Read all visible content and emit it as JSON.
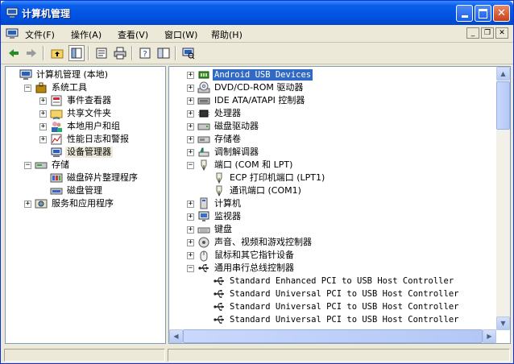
{
  "window": {
    "title": "计算机管理"
  },
  "menu": [
    {
      "label": "文件(F)"
    },
    {
      "label": "操作(A)"
    },
    {
      "label": "查看(V)"
    },
    {
      "label": "窗口(W)"
    },
    {
      "label": "帮助(H)"
    }
  ],
  "toolbar": {
    "icons": [
      "back-arrow-icon",
      "forward-arrow-icon",
      "up-folder-icon",
      "show-hide-tree-icon",
      "properties-icon",
      "print-icon",
      "help-icon",
      "export-list-icon",
      "scan-hardware-icon"
    ]
  },
  "left_tree": [
    {
      "label": "计算机管理 (本地)",
      "level": 0,
      "exp": "",
      "icon": "computer-management-icon"
    },
    {
      "label": "系统工具",
      "level": 1,
      "exp": "-",
      "icon": "system-tools-icon"
    },
    {
      "label": "事件查看器",
      "level": 2,
      "exp": "+",
      "icon": "event-viewer-icon"
    },
    {
      "label": "共享文件夹",
      "level": 2,
      "exp": "+",
      "icon": "shared-folder-icon"
    },
    {
      "label": "本地用户和组",
      "level": 2,
      "exp": "+",
      "icon": "users-icon"
    },
    {
      "label": "性能日志和警报",
      "level": 2,
      "exp": "+",
      "icon": "performance-icon"
    },
    {
      "label": "设备管理器",
      "level": 2,
      "exp": "",
      "icon": "device-manager-icon",
      "selected": true
    },
    {
      "label": "存储",
      "level": 1,
      "exp": "-",
      "icon": "storage-icon"
    },
    {
      "label": "磁盘碎片整理程序",
      "level": 2,
      "exp": "",
      "icon": "defrag-icon"
    },
    {
      "label": "磁盘管理",
      "level": 2,
      "exp": "",
      "icon": "disk-management-icon"
    },
    {
      "label": "服务和应用程序",
      "level": 1,
      "exp": "+",
      "icon": "services-icon"
    }
  ],
  "device_tree": [
    {
      "label": "Android USB Devices",
      "level": 0,
      "exp": "+",
      "icon": "android-device-icon",
      "selected": true,
      "mono": true
    },
    {
      "label": "DVD/CD-ROM 驱动器",
      "level": 0,
      "exp": "+",
      "icon": "cdrom-icon"
    },
    {
      "label": "IDE ATA/ATAPI 控制器",
      "level": 0,
      "exp": "+",
      "icon": "ide-controller-icon"
    },
    {
      "label": "处理器",
      "level": 0,
      "exp": "+",
      "icon": "processor-icon"
    },
    {
      "label": "磁盘驱动器",
      "level": 0,
      "exp": "+",
      "icon": "disk-drive-icon"
    },
    {
      "label": "存储卷",
      "level": 0,
      "exp": "+",
      "icon": "storage-volume-icon"
    },
    {
      "label": "调制解调器",
      "level": 0,
      "exp": "+",
      "icon": "modem-icon"
    },
    {
      "label": "端口 (COM 和 LPT)",
      "level": 0,
      "exp": "-",
      "icon": "port-icon"
    },
    {
      "label": "ECP 打印机端口 (LPT1)",
      "level": 1,
      "exp": "",
      "icon": "port-icon"
    },
    {
      "label": "通讯端口 (COM1)",
      "level": 1,
      "exp": "",
      "icon": "port-icon"
    },
    {
      "label": "计算机",
      "level": 0,
      "exp": "+",
      "icon": "computer-icon"
    },
    {
      "label": "监视器",
      "level": 0,
      "exp": "+",
      "icon": "monitor-icon"
    },
    {
      "label": "键盘",
      "level": 0,
      "exp": "+",
      "icon": "keyboard-icon"
    },
    {
      "label": "声音、视频和游戏控制器",
      "level": 0,
      "exp": "+",
      "icon": "sound-icon"
    },
    {
      "label": "鼠标和其它指针设备",
      "level": 0,
      "exp": "+",
      "icon": "mouse-icon"
    },
    {
      "label": "通用串行总线控制器",
      "level": 0,
      "exp": "-",
      "icon": "usb-icon"
    },
    {
      "label": "Standard Enhanced PCI to USB Host Controller",
      "level": 1,
      "exp": "",
      "icon": "usb-icon",
      "mono": true
    },
    {
      "label": "Standard Universal PCI to USB Host Controller",
      "level": 1,
      "exp": "",
      "icon": "usb-icon",
      "mono": true
    },
    {
      "label": "Standard Universal PCI to USB Host Controller",
      "level": 1,
      "exp": "",
      "icon": "usb-icon",
      "mono": true
    },
    {
      "label": "Standard Universal PCI to USB Host Controller",
      "level": 1,
      "exp": "",
      "icon": "usb-icon",
      "mono": true
    }
  ],
  "colors": {
    "titlebar": "#0054e3",
    "selection": "#316ac5",
    "pane_border": "#7f9db9"
  }
}
